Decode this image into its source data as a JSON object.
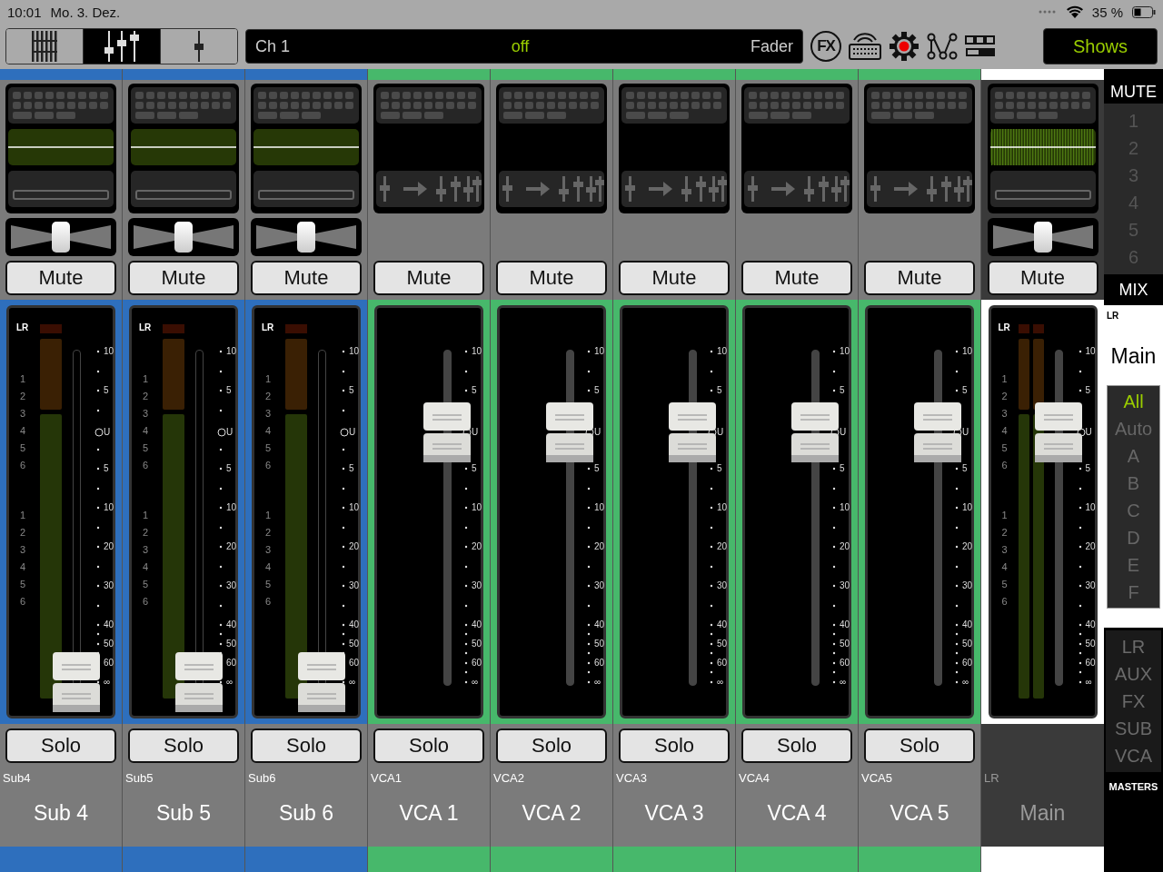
{
  "status_bar": {
    "time": "10:01",
    "date": "Mo. 3. Dez.",
    "battery": "35 %"
  },
  "toolbar": {
    "views": [
      {
        "kind": "strips",
        "selected": false
      },
      {
        "kind": "mixer",
        "selected": true
      },
      {
        "kind": "single",
        "selected": false
      }
    ],
    "display": {
      "channel": "Ch 1",
      "value": "off",
      "parameter": "Fader"
    },
    "fx_label": "FX",
    "shows_button": "Shows"
  },
  "strips": [
    {
      "kind": "sub",
      "color": "#2e6fbd",
      "mute": {
        "label": "Mute",
        "on": false
      },
      "solo": {
        "label": "Solo",
        "on": false
      },
      "pan": {
        "level": 0.5
      },
      "level": 0,
      "meter_title": "LR",
      "meter_labels": [
        "1",
        "2",
        "3",
        "4",
        "5",
        "6",
        "1",
        "2",
        "3",
        "4",
        "5",
        "6"
      ],
      "scale": [
        "10",
        "5",
        "U",
        "5",
        "10",
        "20",
        "30",
        "40",
        "50",
        "60",
        "∞"
      ],
      "short_label": "Sub4",
      "name": "Sub 4"
    },
    {
      "kind": "sub",
      "color": "#2e6fbd",
      "mute": {
        "label": "Mute",
        "on": false
      },
      "solo": {
        "label": "Solo",
        "on": false
      },
      "pan": {
        "level": 0.5
      },
      "level": 0,
      "meter_title": "LR",
      "meter_labels": [
        "1",
        "2",
        "3",
        "4",
        "5",
        "6",
        "1",
        "2",
        "3",
        "4",
        "5",
        "6"
      ],
      "scale": [
        "10",
        "5",
        "U",
        "5",
        "10",
        "20",
        "30",
        "40",
        "50",
        "60",
        "∞"
      ],
      "short_label": "Sub5",
      "name": "Sub 5"
    },
    {
      "kind": "sub",
      "color": "#2e6fbd",
      "mute": {
        "label": "Mute",
        "on": false
      },
      "solo": {
        "label": "Solo",
        "on": false
      },
      "pan": {
        "level": 0.5
      },
      "level": 0,
      "meter_title": "LR",
      "meter_labels": [
        "1",
        "2",
        "3",
        "4",
        "5",
        "6",
        "1",
        "2",
        "3",
        "4",
        "5",
        "6"
      ],
      "scale": [
        "10",
        "5",
        "U",
        "5",
        "10",
        "20",
        "30",
        "40",
        "50",
        "60",
        "∞"
      ],
      "short_label": "Sub6",
      "name": "Sub 6"
    },
    {
      "kind": "vca",
      "color": "#47b86b",
      "mute": {
        "label": "Mute",
        "on": false
      },
      "solo": {
        "label": "Solo",
        "on": false
      },
      "level": 0.755,
      "scale": [
        "10",
        "5",
        "U",
        "5",
        "10",
        "20",
        "30",
        "40",
        "50",
        "60",
        "∞"
      ],
      "short_label": "VCA1",
      "name": "VCA 1"
    },
    {
      "kind": "vca",
      "color": "#47b86b",
      "mute": {
        "label": "Mute",
        "on": false
      },
      "solo": {
        "label": "Solo",
        "on": false
      },
      "level": 0.755,
      "scale": [
        "10",
        "5",
        "U",
        "5",
        "10",
        "20",
        "30",
        "40",
        "50",
        "60",
        "∞"
      ],
      "short_label": "VCA2",
      "name": "VCA 2"
    },
    {
      "kind": "vca",
      "color": "#47b86b",
      "mute": {
        "label": "Mute",
        "on": false
      },
      "solo": {
        "label": "Solo",
        "on": false
      },
      "level": 0.755,
      "scale": [
        "10",
        "5",
        "U",
        "5",
        "10",
        "20",
        "30",
        "40",
        "50",
        "60",
        "∞"
      ],
      "short_label": "VCA3",
      "name": "VCA 3"
    },
    {
      "kind": "vca",
      "color": "#47b86b",
      "mute": {
        "label": "Mute",
        "on": false
      },
      "solo": {
        "label": "Solo",
        "on": false
      },
      "level": 0.755,
      "scale": [
        "10",
        "5",
        "U",
        "5",
        "10",
        "20",
        "30",
        "40",
        "50",
        "60",
        "∞"
      ],
      "short_label": "VCA4",
      "name": "VCA 4"
    },
    {
      "kind": "vca",
      "color": "#47b86b",
      "mute": {
        "label": "Mute",
        "on": false
      },
      "solo": {
        "label": "Solo",
        "on": false
      },
      "level": 0.755,
      "scale": [
        "10",
        "5",
        "U",
        "5",
        "10",
        "20",
        "30",
        "40",
        "50",
        "60",
        "∞"
      ],
      "short_label": "VCA5",
      "name": "VCA 5"
    },
    {
      "kind": "main",
      "color": "#ffffff",
      "mute": {
        "label": "Mute",
        "on": false
      },
      "pan": {
        "level": 0.5
      },
      "level": 0.755,
      "meter_title": "LR",
      "meter_labels": [
        "1",
        "2",
        "3",
        "4",
        "5",
        "6",
        "1",
        "2",
        "3",
        "4",
        "5",
        "6"
      ],
      "scale": [
        "10",
        "5",
        "U",
        "5",
        "10",
        "20",
        "30",
        "40",
        "50",
        "60",
        "∞"
      ],
      "short_label": "LR",
      "name": "Main"
    }
  ],
  "sidebar": {
    "mute_title": "MUTE",
    "mute_groups": [
      {
        "label": "1",
        "on": false
      },
      {
        "label": "2",
        "on": false
      },
      {
        "label": "3",
        "on": false
      },
      {
        "label": "4",
        "on": false
      },
      {
        "label": "5",
        "on": false
      },
      {
        "label": "6",
        "on": false
      }
    ],
    "mix_title": "MIX",
    "mix_short": "LR",
    "mix_name": "Main",
    "filters": [
      {
        "label": "All",
        "selected": true
      },
      {
        "label": "Auto",
        "selected": false
      },
      {
        "label": "A",
        "selected": false
      },
      {
        "label": "B",
        "selected": false
      },
      {
        "label": "C",
        "selected": false
      },
      {
        "label": "D",
        "selected": false
      },
      {
        "label": "E",
        "selected": false
      },
      {
        "label": "F",
        "selected": false
      }
    ],
    "masters": [
      {
        "label": "LR",
        "selected": false
      },
      {
        "label": "AUX",
        "selected": false
      },
      {
        "label": "FX",
        "selected": false
      },
      {
        "label": "SUB",
        "selected": false
      },
      {
        "label": "VCA",
        "selected": false
      }
    ],
    "masters_title": "MASTERS"
  }
}
